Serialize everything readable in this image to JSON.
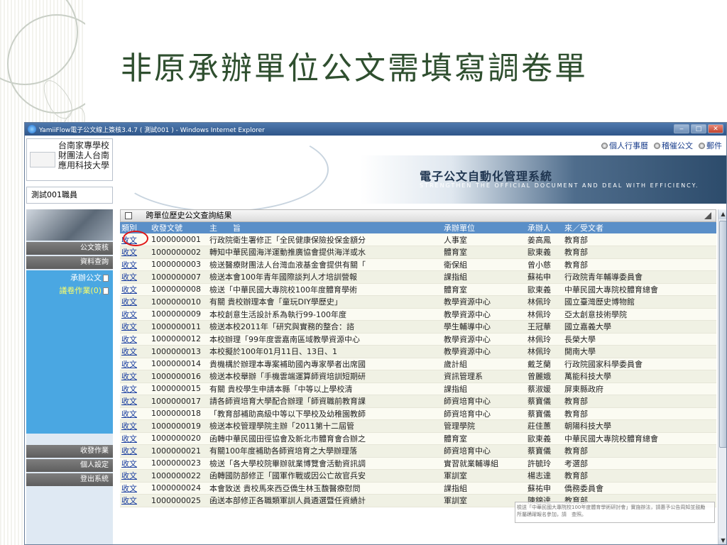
{
  "slide": {
    "title": "非原承辦單位公文需填寫調卷單"
  },
  "window": {
    "title": "YamiiFlow電子公文線上簽核3.4.7 ( 測試001 ) - Windows Internet Explorer",
    "minimize": "‒",
    "maximize": "□",
    "close": "✕"
  },
  "header": {
    "school_lines": [
      "台南家專學校",
      "財團法人台南",
      "應用科技大學"
    ],
    "system_title": "電子公文自動化管理系統",
    "system_subtitle": "STRENGTHEN THE OFFICIAL DOCUMENT AND DEAL WITH EFFICIENCY.",
    "user": "測試001職員",
    "links": [
      {
        "label": "個人行事曆"
      },
      {
        "label": "稽催公文"
      },
      {
        "label": "郵件"
      }
    ]
  },
  "sidebar": {
    "items": [
      "公文簽核",
      "資料查詢"
    ],
    "sub_items": [
      {
        "label": "承辦公文",
        "active": false
      },
      {
        "label": "議卷作業(0)",
        "active": true
      }
    ],
    "bottom_items": [
      "收發作業",
      "個人設定",
      "登出系統"
    ]
  },
  "panel": {
    "title": "跨單位歷史公文查詢結果",
    "columns": [
      "類別",
      "收發文號",
      "主　　旨",
      "承辦單位",
      "承辦人",
      "來／受文者"
    ],
    "rows": [
      [
        "收文",
        "1000000001",
        "行政院衛生署修正「全民健康保險投保金額分",
        "人事室",
        "姜高鳳",
        "教育部"
      ],
      [
        "收文",
        "1000000002",
        "轉知中華民國海洋運動推廣協會提供海洋或水",
        "體育室",
        "歐東義",
        "教育部"
      ],
      [
        "收文",
        "1000000003",
        "檢送醫療財團法人台灣血液基金會提供有關「",
        "衛保組",
        "曾小慈",
        "教育部"
      ],
      [
        "收文",
        "1000000007",
        "檢送本會100年青年國際談判人才培訓營報",
        "課指組",
        "蘇祐申",
        "行政院青年輔導委員會"
      ],
      [
        "收文",
        "1000000008",
        "檢送「中華民國大專院校100年度體育學術",
        "體育室",
        "歐東義",
        "中華民國大專院校體育總會"
      ],
      [
        "收文",
        "1000000010",
        "有關 貴校辦理本會「童玩DIY學歷史」",
        "教學資源中心",
        "林佩玲",
        "國立臺灣歷史博物館"
      ],
      [
        "收文",
        "1000000009",
        "本校創意生活設計系為執行99-100年度",
        "教學資源中心",
        "林佩玲",
        "亞太創意技術學院"
      ],
      [
        "收文",
        "1000000011",
        "檢送本校2011年「研究與實務的整合：諮",
        "學生輔導中心",
        "王冠華",
        "國立嘉義大學"
      ],
      [
        "收文",
        "1000000012",
        "本校辦理「99年度雲嘉南區域教學資源中心",
        "教學資源中心",
        "林佩玲",
        "長榮大學"
      ],
      [
        "收文",
        "1000000013",
        "本校擬於100年01月11日、13日、1",
        "教學資源中心",
        "林佩玲",
        "開南大學"
      ],
      [
        "收文",
        "1000000014",
        "貴機構於辦理本專案補助國內專家學者出席國",
        "歲計組",
        "戴芝蘭",
        "行政院國家科學委員會"
      ],
      [
        "收文",
        "1000000016",
        "檢送本校舉辦「手機雲端運算師資培訓短期研",
        "資訊管理系",
        "曾麗娥",
        "萬能科技大學"
      ],
      [
        "收文",
        "1000000015",
        "有關 貴校學生申請本縣「中等以上學校清",
        "課指組",
        "蔡淑媛",
        "屏東縣政府"
      ],
      [
        "收文",
        "1000000017",
        "請各師資培育大學配合辦理「師資職前教育課",
        "師資培育中心",
        "蔡寶儀",
        "教育部"
      ],
      [
        "收文",
        "1000000018",
        "「教育部補助高級中等以下學校及幼稚園教師",
        "師資培育中心",
        "蔡寶儀",
        "教育部"
      ],
      [
        "收文",
        "1000000019",
        "檢送本校管理學院主辦「2011第十二屆管",
        "管理學院",
        "莊佳蕙",
        "朝陽科技大學"
      ],
      [
        "收文",
        "1000000020",
        "函轉中華民國田徑協會及新北市體育會合辦之",
        "體育室",
        "歐東義",
        "中華民國大專院校體育總會"
      ],
      [
        "收文",
        "1000000021",
        "有關100年度補助各師資培育之大學辦理落",
        "師資培育中心",
        "蔡寶儀",
        "教育部"
      ],
      [
        "收文",
        "1000000023",
        "檢送「各大學校院畢辦就業博覽會活動資訊調",
        "實習就業輔導組",
        "許毓玲",
        "考選部"
      ],
      [
        "收文",
        "1000000022",
        "函轉國防部修正「國軍作戰或因公亡故官兵安",
        "軍訓室",
        "楊志達",
        "教育部"
      ],
      [
        "收文",
        "1000000024",
        "本會致送 貴校馬來西亞僑生林玉馥醫療慰問",
        "課指組",
        "蘇祐申",
        "僑務委員會"
      ],
      [
        "收文",
        "1000000025",
        "函送本部修正各職類軍訓人員遴選暨任資績計",
        "軍訓室",
        "陳錦達",
        "教育部"
      ]
    ],
    "tooltip": "檢送「中華民國大專院校100年度體育學術研討會」實施辦法，請惠予公告周知並鼓勵　所屬踴躍報名參加，請　查照。"
  }
}
